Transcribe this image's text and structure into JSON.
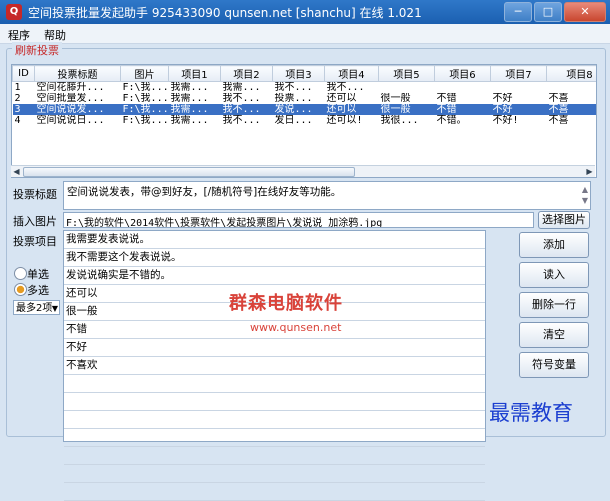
{
  "window": {
    "title": "空间投票批量发起助手   925433090 qunsen.net [shanchu] 在线 1.021",
    "minimize": "─",
    "maximize": "□",
    "close": "✕"
  },
  "menu": [
    "程序",
    "帮助"
  ],
  "group_title": "刷新投票",
  "grid": {
    "columns": [
      "ID",
      "投票标题",
      "图片",
      "项目1",
      "项目2",
      "项目3",
      "项目4",
      "项目5",
      "项目6",
      "项目7",
      "项目8"
    ],
    "rows": [
      [
        "1",
        "空间花藤升...",
        "F:\\我...",
        "我需...",
        "我需...",
        "我不...",
        "我不...",
        "",
        "",
        "",
        ""
      ],
      [
        "2",
        "空间批量发...",
        "F:\\我...",
        "我需...",
        "我不...",
        "投票...",
        "还可以",
        "很一般",
        "不错",
        "不好",
        "不喜"
      ],
      [
        "3",
        "空间说说发...",
        "F:\\我...",
        "我需...",
        "我不...",
        "发说...",
        "还可以",
        "很一般",
        "不错",
        "不好",
        "不喜"
      ],
      [
        "4",
        "空间说说日...",
        "F:\\我...",
        "我需...",
        "我不...",
        "发日...",
        "还可以!",
        "我很...",
        "不错。",
        "不好!",
        "不喜"
      ]
    ],
    "selected_row": 2
  },
  "scroll_arrows": {
    "left": "◀",
    "right": "▶",
    "up": "▲",
    "down": "▼"
  },
  "form": {
    "subject_label": "投票标题",
    "subject_value": "空间说说发表，带@到好友，[/随机符号]在线好友等功能。",
    "image_label": "插入图片",
    "image_path": "F:\\我的软件\\2014软件\\投票软件\\发起投票图片\\发说说 加涂鸦.jpg",
    "choose_image": "选择图片",
    "options_label": "投票项目",
    "single_label": "单选",
    "multi_label": "多选",
    "max_select": "最多2项",
    "options": [
      "我需要发表说说。",
      "我不需要这个发表说说。",
      "发说说确实是不错的。",
      "还可以",
      "很一般",
      "不错",
      "不好",
      "不喜欢",
      "",
      "",
      "",
      "",
      "",
      "",
      ""
    ]
  },
  "buttons": {
    "add": "添加",
    "read": "读入",
    "delete_row": "删除一行",
    "clear": "清空",
    "symbol_change": "符号变量"
  },
  "watermark": {
    "company": "群森电脑软件",
    "url": "www.qunsen.net",
    "corner": "最需教育"
  }
}
